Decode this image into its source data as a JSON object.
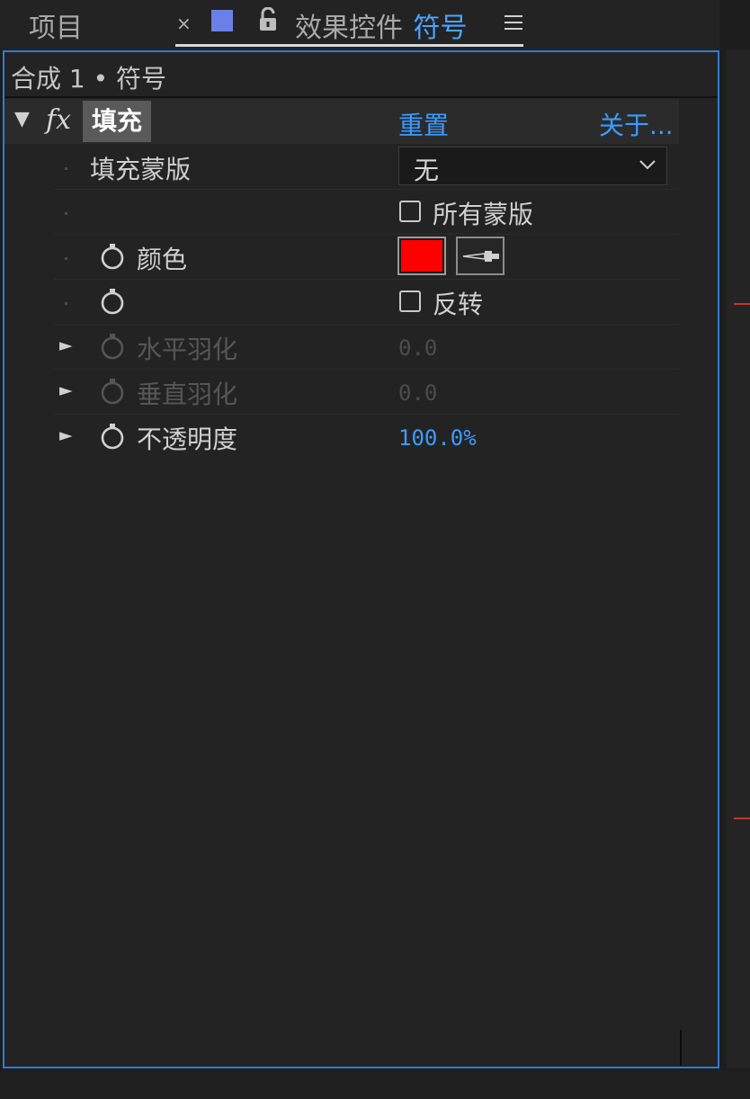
{
  "tabs": {
    "project_label": "项目",
    "close_glyph": "×",
    "swatch_color": "#6b7fe6",
    "title_prefix": "效果控件",
    "title_layer": "符号",
    "accent_color": "#4da3ff"
  },
  "breadcrumb": "合成 1 • 符号",
  "effect": {
    "name": "填充",
    "fx_label": "fx",
    "reset_label": "重置",
    "about_label": "关于..."
  },
  "properties": {
    "fill_mask_label": "填充蒙版",
    "fill_mask_value": "无",
    "all_masks_label": "所有蒙版",
    "color_label": "颜色",
    "color_value": "#ff0000",
    "invert_label": "反转",
    "h_feather_label": "水平羽化",
    "h_feather_value": "0.0",
    "v_feather_label": "垂直羽化",
    "v_feather_value": "0.0",
    "opacity_label": "不透明度",
    "opacity_value": "100.0%"
  },
  "icons": {
    "twirl": "▼",
    "expand": "►"
  }
}
